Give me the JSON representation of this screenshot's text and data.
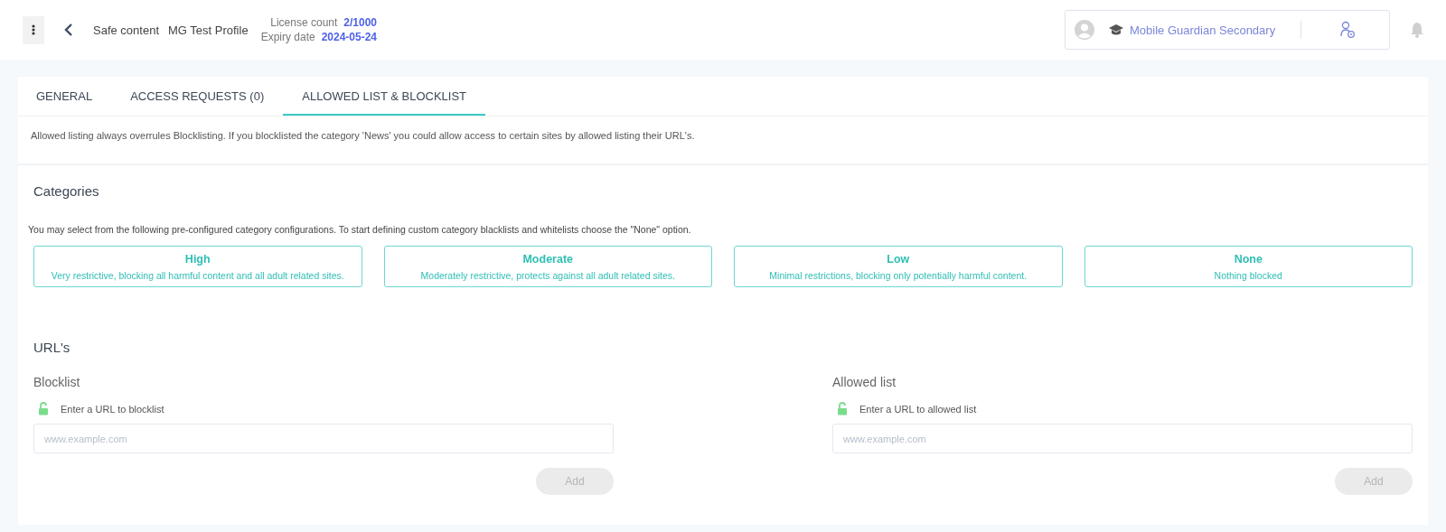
{
  "header": {
    "breadcrumb": [
      "Safe content",
      "MG Test Profile"
    ],
    "license_label": "License count",
    "license_value": "2/1000",
    "expiry_label": "Expiry date",
    "expiry_value": "2024-05-24",
    "school": "Mobile Guardian Secondary"
  },
  "tabs": [
    {
      "label": "GENERAL",
      "selected": false
    },
    {
      "label": "ACCESS REQUESTS (0)",
      "selected": false
    },
    {
      "label": "ALLOWED LIST & BLOCKLIST",
      "selected": true
    }
  ],
  "info": "Allowed listing always overrules Blocklisting. If you blocklisted the category 'News' you could allow access to certain sites by allowed listing their URL's.",
  "categories": {
    "title": "Categories",
    "description": "You may select from the following pre-configured category configurations. To start defining custom category blacklists and whitelists choose the \"None\" option.",
    "options": [
      {
        "name": "High",
        "detail": "Very restrictive, blocking all harmful content and all adult related sites.",
        "selected": false
      },
      {
        "name": "Moderate",
        "detail": "Moderately restrictive, protects against all adult related sites.",
        "selected": false
      },
      {
        "name": "Low",
        "detail": "Minimal restrictions, blocking only potentially harmful content.",
        "selected": false
      },
      {
        "name": "None",
        "detail": "Nothing blocked",
        "selected": false
      }
    ]
  },
  "urls": {
    "title": "URL's",
    "lists": [
      {
        "title": "Blocklist",
        "label": "Enter a URL to blocklist",
        "placeholder": "www.example.com",
        "button": "Add",
        "disabled": true
      },
      {
        "title": "Allowed list",
        "label": "Enter a URL to allowed list",
        "placeholder": "www.example.com",
        "button": "Add",
        "disabled": true
      }
    ]
  }
}
